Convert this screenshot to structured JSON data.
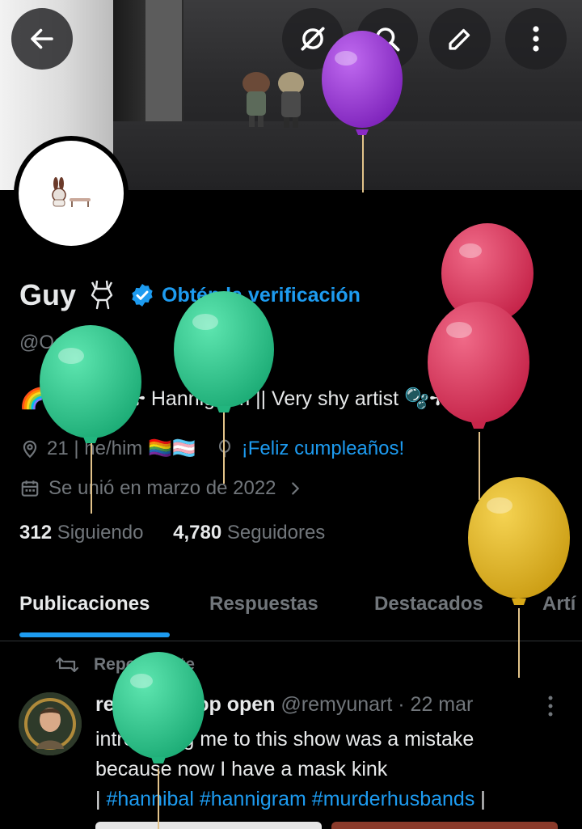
{
  "profile": {
    "name": "Guy",
    "verify_label": "Obtén la verificación",
    "handle": "@OoYeGu",
    "bio": "🌈🌿||HEU ✢ Hannigram || Very shy artist 🫧✢ 🔞",
    "location": "21 | he/him 🏳️‍🌈🏳️‍⚧️",
    "birthday": "¡Feliz cumpleaños!",
    "joined": "Se unió en marzo de 2022",
    "following_count": "312",
    "following_label": "Siguiendo",
    "followers_count": "4,780",
    "followers_label": "Seguidores"
  },
  "tabs": [
    "Publicaciones",
    "Respuestas",
    "Destacados",
    "Artí"
  ],
  "post": {
    "repost_label": "Reposteaste",
    "author_name": "remy ★ shop open",
    "author_handle": "@remyunart",
    "date": "· 22 mar",
    "text_line1": "introducing me to this show was a mistake",
    "text_line2": "because now I have a mask kink",
    "text_prefix": "|",
    "hashtags": "#hannibal #hannigram #murderhusbands",
    "text_suffix": "|"
  },
  "colors": {
    "accent": "#1d9bf0",
    "muted": "#71767b",
    "text": "#e7e9ea",
    "balloon_purple": "#9b30d6",
    "balloon_green": "#2fcf8f",
    "balloon_red": "#e0365a",
    "balloon_gold": "#e0b321"
  },
  "icons": [
    "back-arrow-icon",
    "grok-icon",
    "search-icon",
    "edit-icon",
    "more-icon",
    "verified-badge-icon",
    "location-icon",
    "balloon-icon",
    "calendar-icon",
    "chevron-right-icon",
    "repost-icon"
  ]
}
